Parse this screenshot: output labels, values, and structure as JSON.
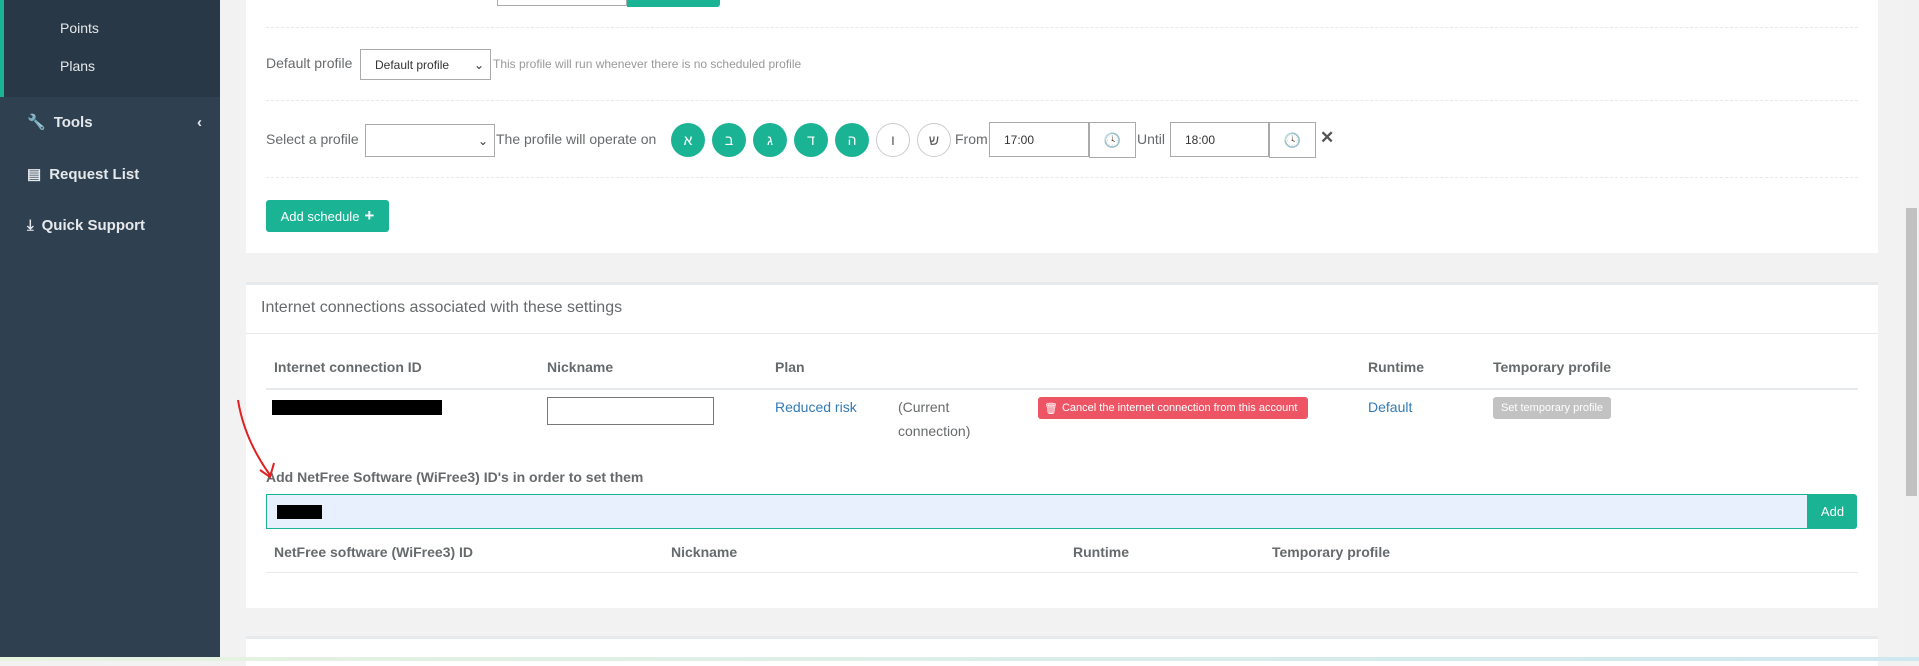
{
  "sidebar": {
    "sub_items": [
      "Points",
      "Plans"
    ],
    "items": [
      {
        "label": "Tools",
        "icon": "wrench-icon"
      },
      {
        "label": "Request List",
        "icon": "list-icon"
      },
      {
        "label": "Quick Support",
        "icon": "download-icon"
      }
    ]
  },
  "schedule": {
    "default_label": "Default profile",
    "default_value": "Default profile",
    "default_help": "This profile will run whenever there is no scheduled profile",
    "select_label": "Select a profile",
    "select_value": "",
    "operate_label": "The profile will operate on",
    "days": [
      {
        "l": "א",
        "on": true
      },
      {
        "l": "ב",
        "on": true
      },
      {
        "l": "ג",
        "on": true
      },
      {
        "l": "ד",
        "on": true
      },
      {
        "l": "ה",
        "on": true
      },
      {
        "l": "ו",
        "on": false
      },
      {
        "l": "ש",
        "on": false
      }
    ],
    "from_label": "From",
    "from_value": "17:00",
    "until_label": "Until",
    "until_value": "18:00",
    "add_schedule": "Add schedule"
  },
  "connections": {
    "title": "Internet connections associated with these settings",
    "headers": [
      "Internet connection ID",
      "Nickname",
      "Plan",
      "Runtime",
      "Temporary profile"
    ],
    "row": {
      "nickname": "",
      "plan": "Reduced risk",
      "current": "(Current",
      "current2": "connection)",
      "cancel": "Cancel the internet connection from this account",
      "runtime": "Default",
      "temp": "Set temporary profile"
    },
    "add_label": "Add NetFree Software (WiFree3) ID's in order to set them",
    "add_button": "Add",
    "sub_headers": [
      "NetFree software (WiFree3) ID",
      "Nickname",
      "Runtime",
      "Temporary profile"
    ]
  },
  "colors": {
    "accent": "#1ab394",
    "danger": "#ed5565",
    "sidebar": "#2f4050"
  }
}
